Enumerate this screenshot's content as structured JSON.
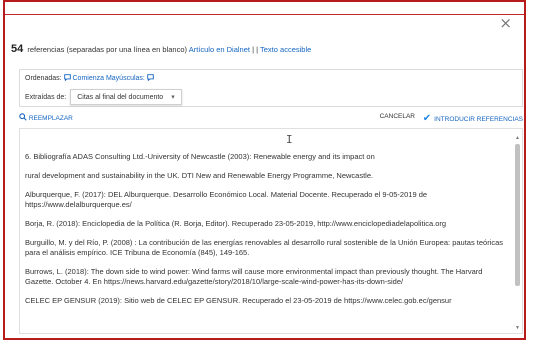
{
  "dialog": {
    "close_glyph": "×",
    "ref_count": "54",
    "ref_text": " referencias (separadas por una línea en blanco)",
    "link_article": "Artículo en Dialnet",
    "link_separator": " | | ",
    "link_accessible": "Texto accesible"
  },
  "options": {
    "sorted_label": "Ordenadas:",
    "sorted_link": "Comienza Mayúsculas:",
    "extracted_label": "Extraídas de:",
    "extracted_value": "Citas al final del documento"
  },
  "actions": {
    "replace_label": "REEMPLAZAR",
    "cancel_label": "CANCELAR",
    "insert_label": "INTRODUCIR REFERENCIAS"
  },
  "references": [
    "6. Bibliografía ADAS Consulting Ltd.-University of Newcastle (2003): Renewable energy and its impact on",
    "rural development and sustainability in the UK. DTI New and Renewable Energy Programme, Newcastle.",
    "Alburquerque, F. (2017): DEL Alburquerque. Desarrollo Económico Local. Material Docente. Recuperado el 9-05-2019 de https://www.delalburquerque.es/",
    "Borja, R. (2018): Enciclopedia de la Política (R. Borja, Editor). Recuperado 23-05-2019, http://www.enciclopediadelapolitica.org",
    "Burguillo, M. y del Río, P. (2008) : La contribución de las energías renovables al desarrollo rural sostenible de la Unión Europea: pautas teóricas para el análisis empírico. ICE Tribuna de Economía (845), 149-165.",
    "Burrows, L. (2018): The down side to wind power: Wind farms will cause more environmental impact than previously thought. The Harvard Gazette. October 4. En https://news.harvard.edu/gazette/story/2018/10/large-scale-wind-power-has-its-down-side/",
    "CELEC EP GENSUR (2019): Sitio web de CELEC EP GENSUR. Recuperado el 23-05-2019 de https://www.celec.gob.ec/gensur"
  ]
}
